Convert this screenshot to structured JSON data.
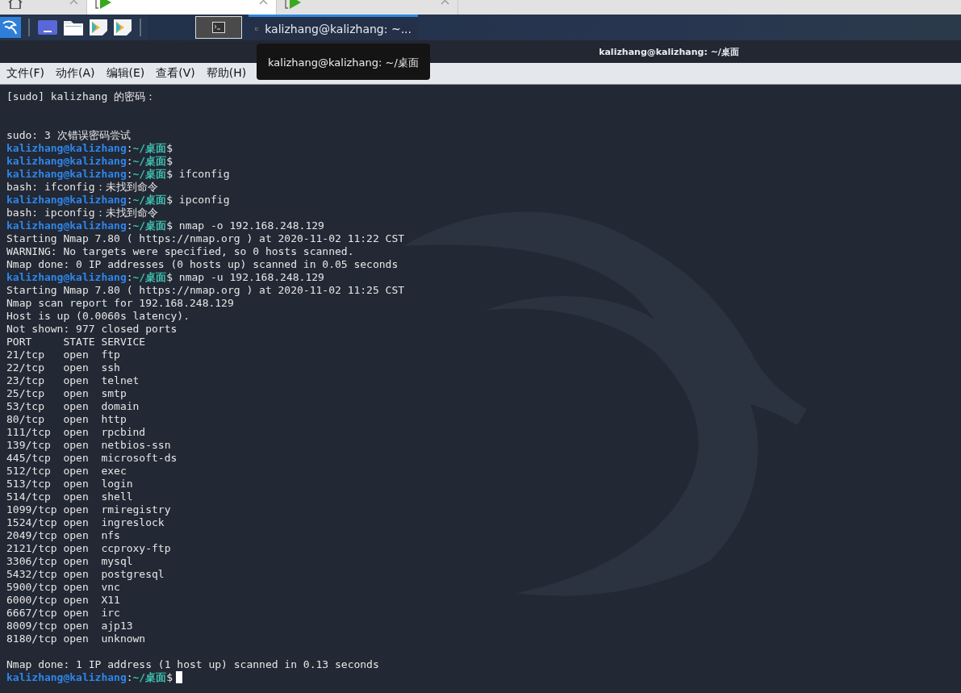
{
  "browser_tabs": [
    {
      "selected": false
    },
    {
      "selected": true
    },
    {
      "selected": false
    }
  ],
  "panel": {
    "launchers": [
      {
        "kind": "workspace"
      },
      {
        "kind": "folder"
      },
      {
        "kind": "editor"
      },
      {
        "kind": "editor"
      }
    ],
    "workspace_selected": true,
    "task": {
      "title": "kalizhang@kalizhang: ~...",
      "selected": true
    }
  },
  "window": {
    "title": "kalizhang@kalizhang: ~/桌面"
  },
  "tooltip": {
    "text": "kalizhang@kalizhang: ~/桌面"
  },
  "menu": [
    "文件(F)",
    "动作(A)",
    "编辑(E)",
    "查看(V)",
    "帮助(H)"
  ],
  "terminal": {
    "cursor_visible": true,
    "lines": [
      {
        "kind": "output",
        "text": "[sudo] kalizhang 的密码："
      },
      {
        "kind": "blank"
      },
      {
        "kind": "blank"
      },
      {
        "kind": "output",
        "text": "sudo: 3 次错误密码尝试"
      },
      {
        "kind": "prompt",
        "user": "kalizhang@kalizhang",
        "colon": ":",
        "path": "~/桌面",
        "symbol": "$"
      },
      {
        "kind": "prompt",
        "user": "kalizhang@kalizhang",
        "colon": ":",
        "path": "~/桌面",
        "symbol": "$"
      },
      {
        "kind": "prompt",
        "user": "kalizhang@kalizhang",
        "colon": ":",
        "path": "~/桌面",
        "symbol": "$",
        "command": "ifconfig"
      },
      {
        "kind": "output",
        "text": "bash: ifconfig：未找到命令"
      },
      {
        "kind": "prompt",
        "user": "kalizhang@kalizhang",
        "colon": ":",
        "path": "~/桌面",
        "symbol": "$",
        "command": "ipconfig"
      },
      {
        "kind": "output",
        "text": "bash: ipconfig：未找到命令"
      },
      {
        "kind": "prompt",
        "user": "kalizhang@kalizhang",
        "colon": ":",
        "path": "~/桌面",
        "symbol": "$",
        "command": "nmap -o 192.168.248.129"
      },
      {
        "kind": "output",
        "text": "Starting Nmap 7.80 ( https://nmap.org ) at 2020-11-02 11:22 CST"
      },
      {
        "kind": "output",
        "text": "WARNING: No targets were specified, so 0 hosts scanned."
      },
      {
        "kind": "output",
        "text": "Nmap done: 0 IP addresses (0 hosts up) scanned in 0.05 seconds"
      },
      {
        "kind": "prompt",
        "user": "kalizhang@kalizhang",
        "colon": ":",
        "path": "~/桌面",
        "symbol": "$",
        "command": "nmap -u 192.168.248.129"
      },
      {
        "kind": "output",
        "text": "Starting Nmap 7.80 ( https://nmap.org ) at 2020-11-02 11:25 CST"
      },
      {
        "kind": "output",
        "text": "Nmap scan report for 192.168.248.129"
      },
      {
        "kind": "output",
        "text": "Host is up (0.0060s latency)."
      },
      {
        "kind": "output",
        "text": "Not shown: 977 closed ports"
      },
      {
        "kind": "output",
        "text": "PORT     STATE SERVICE"
      },
      {
        "kind": "output",
        "text": "21/tcp   open  ftp"
      },
      {
        "kind": "output",
        "text": "22/tcp   open  ssh"
      },
      {
        "kind": "output",
        "text": "23/tcp   open  telnet"
      },
      {
        "kind": "output",
        "text": "25/tcp   open  smtp"
      },
      {
        "kind": "output",
        "text": "53/tcp   open  domain"
      },
      {
        "kind": "output",
        "text": "80/tcp   open  http"
      },
      {
        "kind": "output",
        "text": "111/tcp  open  rpcbind"
      },
      {
        "kind": "output",
        "text": "139/tcp  open  netbios-ssn"
      },
      {
        "kind": "output",
        "text": "445/tcp  open  microsoft-ds"
      },
      {
        "kind": "output",
        "text": "512/tcp  open  exec"
      },
      {
        "kind": "output",
        "text": "513/tcp  open  login"
      },
      {
        "kind": "output",
        "text": "514/tcp  open  shell"
      },
      {
        "kind": "output",
        "text": "1099/tcp open  rmiregistry"
      },
      {
        "kind": "output",
        "text": "1524/tcp open  ingreslock"
      },
      {
        "kind": "output",
        "text": "2049/tcp open  nfs"
      },
      {
        "kind": "output",
        "text": "2121/tcp open  ccproxy-ftp"
      },
      {
        "kind": "output",
        "text": "3306/tcp open  mysql"
      },
      {
        "kind": "output",
        "text": "5432/tcp open  postgresql"
      },
      {
        "kind": "output",
        "text": "5900/tcp open  vnc"
      },
      {
        "kind": "output",
        "text": "6000/tcp open  X11"
      },
      {
        "kind": "output",
        "text": "6667/tcp open  irc"
      },
      {
        "kind": "output",
        "text": "8009/tcp open  ajp13"
      },
      {
        "kind": "output",
        "text": "8180/tcp open  unknown"
      },
      {
        "kind": "blank"
      },
      {
        "kind": "output",
        "text": "Nmap done: 1 IP address (1 host up) scanned in 0.13 seconds"
      },
      {
        "kind": "prompt",
        "user": "kalizhang@kalizhang",
        "colon": ":",
        "path": "~/桌面",
        "symbol": "$"
      }
    ]
  }
}
